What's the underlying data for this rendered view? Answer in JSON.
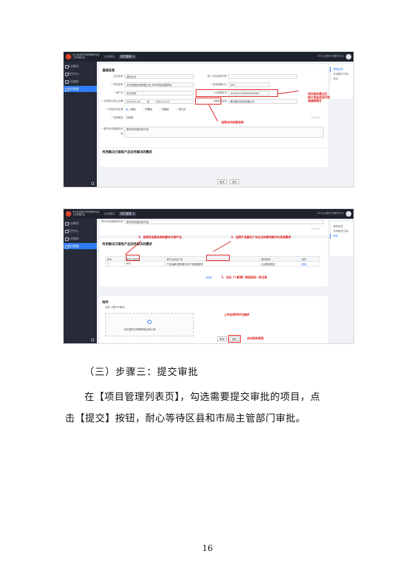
{
  "app": {
    "logo_text": "中小企业数字化转型城市试点工作管理平台",
    "user_text": "中小企业数字化服务平台",
    "tabs": [
      {
        "label": "企业概况"
      },
      {
        "label": "项目管理 ✕"
      }
    ],
    "sidebar": [
      {
        "label": "企业概况"
      },
      {
        "label": "项目中心"
      },
      {
        "label": "企业服务"
      },
      {
        "label": "项目管理"
      }
    ],
    "rnav": [
      "基础信息",
      "所用解决方案...",
      "附件"
    ]
  },
  "form1": {
    "section_title": "基础信息",
    "fields": {
      "company_name_label": "企业名称",
      "company_name_value": "演示企业",
      "credit_code_label": "统一社会信用代码",
      "credit_code_value": "",
      "project_name_label": "* 项目名称",
      "project_name_value": "中外信息技术有限公司_MES项目实施项目",
      "investment_label": "* 投资金额(万)",
      "investment_value": "100",
      "user_label": "* 用户名",
      "user_value": "华为测试",
      "contract_no_label": "* 合同服务号",
      "contract_no_value": "2024011700050000007",
      "contract_date_label": "* 合同签订起止日期",
      "date_start": "2024-01-01",
      "date_sep": "至",
      "date_end": "2024-12-31",
      "vendor_label": "* 服务商名称",
      "vendor_value": "腾讯数字科技有限公司",
      "location_label": "* 项目所在区域",
      "radios": [
        "上城区",
        "拱墅区",
        "西湖区",
        "滨江区"
      ],
      "status_label": "* 完成情况",
      "status_value": "已验收",
      "desc_label": "* 数字化改造建设内容",
      "desc_value": "数字化改造内容介绍",
      "char_count": "0/1000"
    },
    "next_section": "所用解决方案和产品及所解决的需求",
    "buttons": {
      "cancel": "取消",
      "save": "保存"
    },
    "annotations": {
      "right_note": "项目验收通过后\n统计资金会回付到此账号\n请谨慎填写",
      "bottom_note": "选择合作的服务商"
    }
  },
  "form2": {
    "top_label": "数字化改造建设内容",
    "top_value": "数字化改造内容介绍",
    "section_title": "所用解决方案和产品及所解决的需求",
    "table_headers": [
      "序号",
      "解决方案名称",
      "数字化改造产品",
      "解决需求",
      "操作"
    ],
    "table_rows": [
      {
        "no": "1",
        "solution": "MES",
        "product": "产品及解决需求数字化产品规格型号",
        "need": "企业需求描述",
        "op": "删除"
      }
    ],
    "add_row": "+新增",
    "attach_title": "附件",
    "contract_label": "合同（限PDF格式）",
    "upload_text": "点击或将文件拖拽到此区域上传",
    "buttons": {
      "cancel": "取消",
      "save": "保存"
    },
    "annotations": {
      "a2": "2、选择所选服务商的解决方案产品",
      "a3": "3、选择产品解决了本企业的哪项数字化改造需求",
      "a1": "1、点击【+新增】按钮添加一条记录",
      "upload": "上传合同PDF扫描件",
      "save": "点击保存按钮"
    }
  },
  "doc": {
    "heading": "（三）步骤三：提交审批",
    "para_line1": "在【项目管理列表页】，勾选需要提交审批的项目，点",
    "para_line2": "击【提交】按钮，耐心等待区县和市局主管部门审批。",
    "page_number": "16"
  }
}
